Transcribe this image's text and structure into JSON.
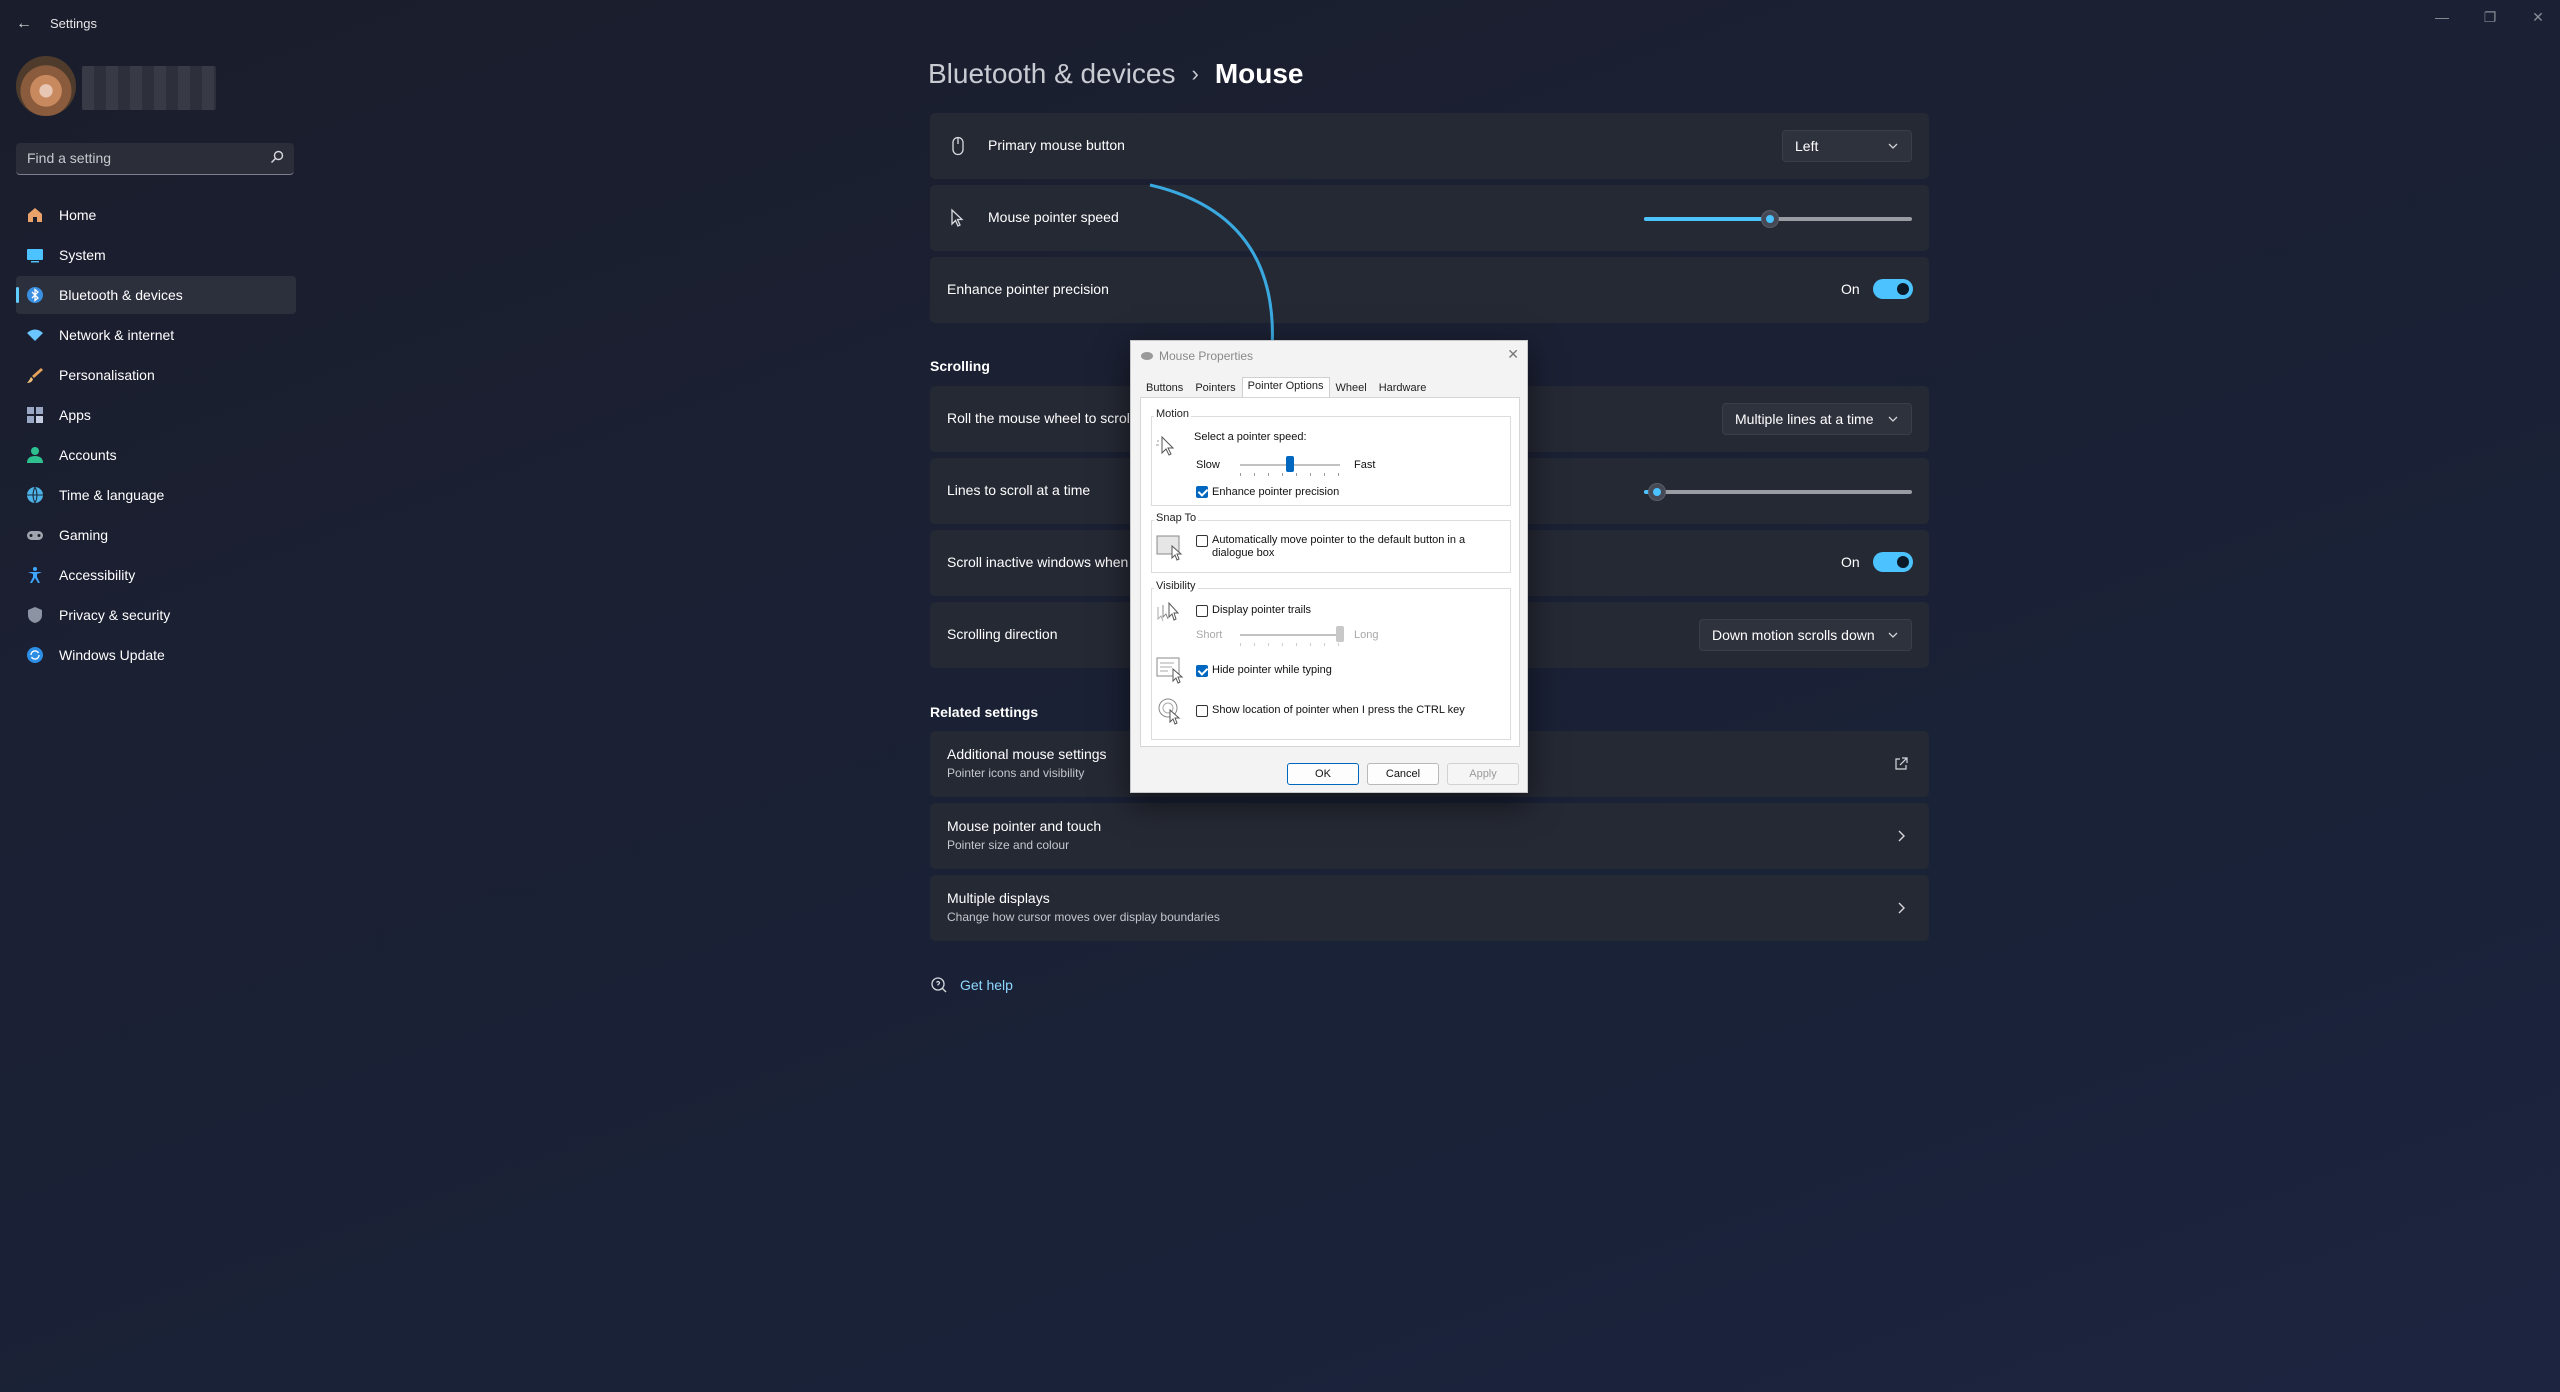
{
  "window": {
    "back_label": "←",
    "app_title": "Settings",
    "minimize_label": "—",
    "restore_label": "❐",
    "close_label": "✕"
  },
  "sidebar": {
    "search": {
      "placeholder": "Find a setting"
    },
    "items": [
      {
        "label": "Home",
        "icon": "home-icon",
        "color": "#e8a26a"
      },
      {
        "label": "System",
        "icon": "system-icon",
        "color": "#4cc2ff"
      },
      {
        "label": "Bluetooth & devices",
        "icon": "bluetooth-icon",
        "color": "#3b8fe0",
        "active": true
      },
      {
        "label": "Network & internet",
        "icon": "wifi-icon",
        "color": "#6bc6ff"
      },
      {
        "label": "Personalisation",
        "icon": "brush-icon",
        "color": "#e6a15a"
      },
      {
        "label": "Apps",
        "icon": "apps-icon",
        "color": "#9aa7c4"
      },
      {
        "label": "Accounts",
        "icon": "accounts-icon",
        "color": "#2ec08e"
      },
      {
        "label": "Time & language",
        "icon": "globe-icon",
        "color": "#4db2e8"
      },
      {
        "label": "Gaming",
        "icon": "gamepad-icon",
        "color": "#a0a4ae"
      },
      {
        "label": "Accessibility",
        "icon": "accessibility-icon",
        "color": "#3fa6ff"
      },
      {
        "label": "Privacy & security",
        "icon": "shield-icon",
        "color": "#8c93a3"
      },
      {
        "label": "Windows Update",
        "icon": "update-icon",
        "color": "#2d8ee6"
      }
    ]
  },
  "breadcrumb": {
    "parent": "Bluetooth & devices",
    "separator": "›",
    "current": "Mouse"
  },
  "settings": {
    "primary_button": {
      "label": "Primary mouse button",
      "value": "Left"
    },
    "pointer_speed": {
      "label": "Mouse pointer speed",
      "value_fraction": 0.47
    },
    "enhance_precision": {
      "label": "Enhance pointer precision",
      "state": "On"
    },
    "scrolling_title": "Scrolling",
    "roll_wheel": {
      "label": "Roll the mouse wheel to scrol",
      "value": "Multiple lines at a time"
    },
    "lines_scroll": {
      "label": "Lines to scroll at a time",
      "value_fraction": 0.05
    },
    "scroll_inactive": {
      "label": "Scroll inactive windows when",
      "state": "On"
    },
    "scroll_direction": {
      "label": "Scrolling direction",
      "value": "Down motion scrolls down"
    }
  },
  "related": {
    "title": "Related settings",
    "items": [
      {
        "title": "Additional mouse settings",
        "subtitle": "Pointer icons and visibility",
        "icon": "external-link-icon"
      },
      {
        "title": "Mouse pointer and touch",
        "subtitle": "Pointer size and colour",
        "icon": "chevron-right-icon"
      },
      {
        "title": "Multiple displays",
        "subtitle": "Change how cursor moves over display boundaries",
        "icon": "chevron-right-icon"
      }
    ]
  },
  "get_help": "Get help",
  "dialog": {
    "title": "Mouse Properties",
    "close_label": "✕",
    "tabs": [
      "Buttons",
      "Pointers",
      "Pointer Options",
      "Wheel",
      "Hardware"
    ],
    "active_tab": "Pointer Options",
    "motion": {
      "group": "Motion",
      "speed_label": "Select a pointer speed:",
      "slow": "Slow",
      "fast": "Fast",
      "speed_fraction": 0.5,
      "enhance": {
        "label": "Enhance pointer precision",
        "checked": true
      }
    },
    "snap": {
      "group": "Snap To",
      "label_line1": "Automatically move pointer to the default button in a",
      "label_line2": "dialogue box",
      "checked": false
    },
    "visibility": {
      "group": "Visibility",
      "trails": {
        "label": "Display pointer trails",
        "checked": false
      },
      "short": "Short",
      "long": "Long",
      "trails_fraction": 1.0,
      "hide_typing": {
        "label": "Hide pointer while typing",
        "checked": true
      },
      "show_ctrl": {
        "label": "Show location of pointer when I press the CTRL key",
        "checked": false
      }
    },
    "buttons": {
      "ok": "OK",
      "cancel": "Cancel",
      "apply": "Apply"
    }
  },
  "colors": {
    "accent": "#4cc2ff",
    "card": "#252934",
    "dialog_accent": "#0067c0",
    "annotation_arrow": "#3aa9e0"
  }
}
